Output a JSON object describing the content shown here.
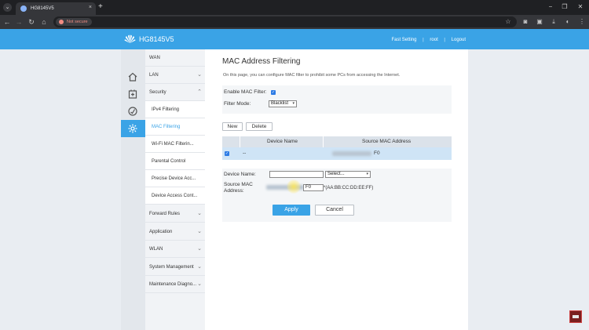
{
  "browser": {
    "tab_title": "HG8145V5",
    "tab_close": "×",
    "new_tab": "+",
    "tab_search": "⌄",
    "security_chip": "Not secure",
    "window_controls": [
      "−",
      "❐",
      "✕"
    ],
    "nav": {
      "back": "←",
      "forward": "→",
      "reload": "↻",
      "home": "⌂"
    },
    "toolbar_icons": [
      "star-icon",
      "camera-icon",
      "extensions-icon",
      "downloads-icon",
      "menu-icon"
    ]
  },
  "header": {
    "product_name": "HG8145V5",
    "links": [
      "Fast Setting",
      "root",
      "Logout"
    ],
    "separator": "|",
    "brand_color": "#3aa3e6"
  },
  "icon_strip": [
    "home-icon",
    "advanced-icon",
    "status-icon",
    "settings-icon"
  ],
  "sidebar": {
    "items": [
      {
        "label": "WAN",
        "expandable": false
      },
      {
        "label": "LAN",
        "expandable": true,
        "chevron": "⌄"
      },
      {
        "label": "Security",
        "expandable": true,
        "expanded": true,
        "chevron": "⌃"
      },
      {
        "label": "IPv4 Filtering",
        "sub": true
      },
      {
        "label": "MAC Filtering",
        "sub": true,
        "active": true
      },
      {
        "label": "Wi-Fi MAC Filterin...",
        "sub": true
      },
      {
        "label": "Parental Control",
        "sub": true
      },
      {
        "label": "Precise Device Acc...",
        "sub": true
      },
      {
        "label": "Device Access Cont...",
        "sub": true
      },
      {
        "label": "Forward Rules",
        "expandable": true,
        "chevron": "⌄"
      },
      {
        "label": "Application",
        "expandable": true,
        "chevron": "⌄"
      },
      {
        "label": "WLAN",
        "expandable": true,
        "chevron": "⌄"
      },
      {
        "label": "System Management",
        "expandable": true,
        "chevron": "⌄"
      },
      {
        "label": "Maintenance Diagno...",
        "expandable": true,
        "chevron": "⌄"
      }
    ]
  },
  "main": {
    "title": "MAC Address Filtering",
    "description": "On this page, you can configure MAC filter to prohibit some PCs from accessing the Internet.",
    "enable_label": "Enable MAC Filter:",
    "enable_checked": true,
    "check_mark": "✓",
    "mode_label": "Filter Mode:",
    "mode_value": "Blacklist",
    "new_button": "New",
    "delete_button": "Delete",
    "table": {
      "columns": [
        "Device Name",
        "Source MAC Address"
      ],
      "rows": [
        {
          "selected": true,
          "device_name": "--",
          "mac_suffix": "F0"
        }
      ]
    },
    "form": {
      "device_name_label": "Device Name:",
      "device_name_value": "",
      "device_select": "Select...",
      "mac_label_line1": "Source MAC",
      "mac_label_line2": "Address:",
      "mac_value_suffix": "F0",
      "mac_hint": "*(AA:BB:CC:DD:EE:FF)"
    },
    "apply_button": "Apply",
    "cancel_button": "Cancel"
  }
}
